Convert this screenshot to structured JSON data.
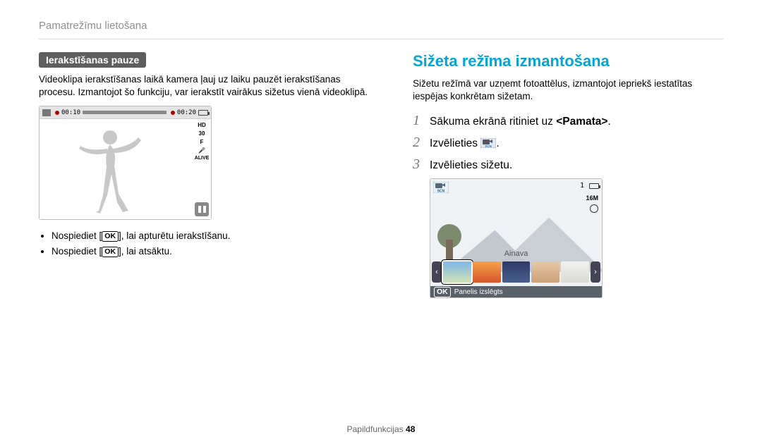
{
  "breadcrumb": "Pamatrežīmu lietošana",
  "left": {
    "pill": "Ierakstīšanas pauze",
    "para": "Videoklipa ierakstīšanas laikā kamera ļauj uz laiku pauzēt ierakstīšanas procesu. Izmantojot šo funkciju, var ierakstīt vairākus sižetus vienā videoklipā.",
    "lcd": {
      "time_left": "00:10",
      "time_right": "00:20",
      "hd": "HD",
      "thirty": "30",
      "f": "F",
      "alive": "ALIVE"
    },
    "ok_label": "OK",
    "bullet1_a": "Nospiediet [",
    "bullet1_b": "], lai apturētu ierakstīšanu.",
    "bullet2_a": "Nospiediet [",
    "bullet2_b": "], lai atsāktu."
  },
  "right": {
    "heading": "Sižeta režīma izmantošana",
    "para": "Sižetu režīmā var uzņemt fotoattēlus, izmantojot iepriekš iestatītas iespējas konkrētam sižetam.",
    "step1_a": "Sākuma ekrānā ritiniet uz ",
    "step1_b": "<Pamata>",
    "step1_c": ".",
    "step2_a": "Izvēlieties ",
    "step2_b": ".",
    "step3": "Izvēlieties sižetu.",
    "lcd2": {
      "count": "1",
      "sixteen": "16M",
      "ainava": "Ainava",
      "panel_off": "Panelis izslēgts",
      "scn_top": "SCN",
      "scn_bottom": "SCN"
    },
    "num1": "1",
    "num2": "2",
    "num3": "3"
  },
  "footer_a": "Papildfunkcijas  ",
  "footer_b": "48"
}
